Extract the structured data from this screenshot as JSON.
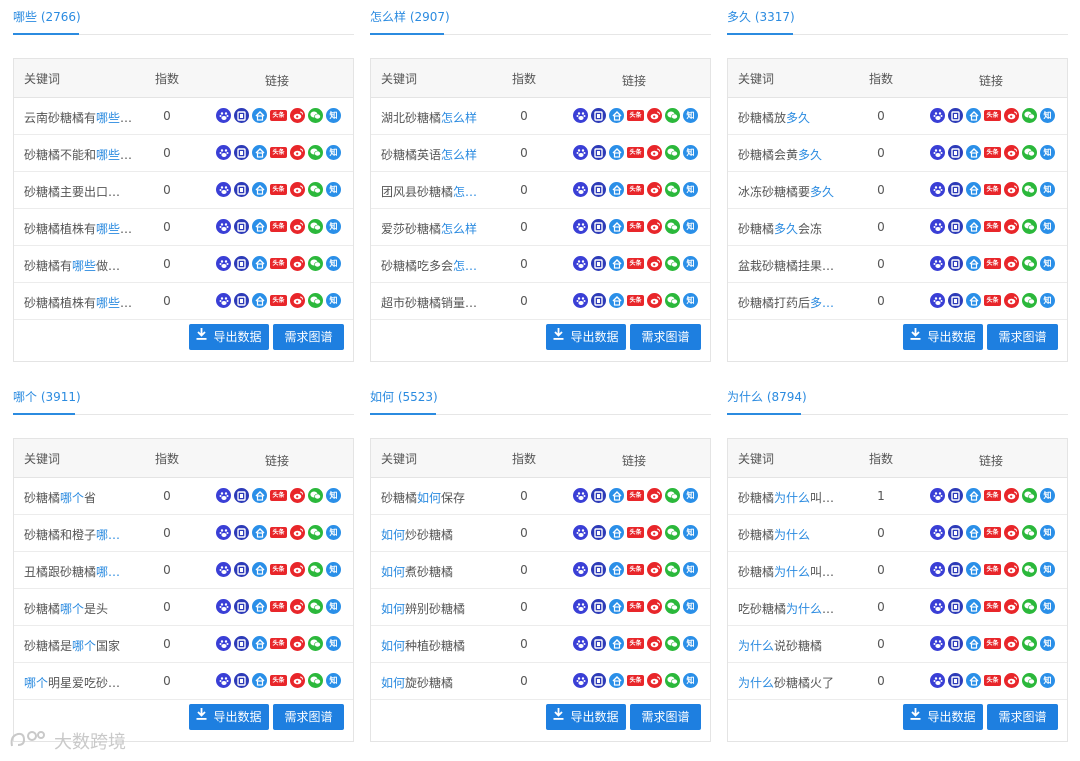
{
  "columns": {
    "keyword": "关键词",
    "index": "指数",
    "links": "链接"
  },
  "buttons": {
    "export": "导出数据",
    "graph": "需求图谱"
  },
  "watermark": "大数跨境",
  "colors": {
    "accent": "#2b8be0",
    "button": "#1e7fe0",
    "baidu": "#3a3fd6",
    "weibo": "#e8262a",
    "wechat": "#2bb83b",
    "zhihu": "#2a8fe8"
  },
  "link_icons": [
    "baidu-icon",
    "docs-icon",
    "baike-icon",
    "toutiao-icon",
    "weibo-icon",
    "wechat-icon",
    "zhihu-icon"
  ],
  "panels": [
    {
      "title": "哪些 (2766)",
      "rows": [
        {
          "pre": "云南砂糖橘有",
          "hl": "哪些",
          "post": "…",
          "index": "0"
        },
        {
          "pre": "砂糖橘不能和",
          "hl": "哪些",
          "post": "…",
          "index": "0"
        },
        {
          "pre": "砂糖橘主要出口…",
          "hl": "",
          "post": "",
          "index": "0"
        },
        {
          "pre": "砂糖橘植株有",
          "hl": "哪些",
          "post": "…",
          "index": "0"
        },
        {
          "pre": "砂糖橘有",
          "hl": "哪些",
          "post": "做…",
          "index": "0"
        },
        {
          "pre": "砂糖橘植株有",
          "hl": "哪些",
          "post": "…",
          "index": "0"
        }
      ]
    },
    {
      "title": "怎么样 (2907)",
      "rows": [
        {
          "pre": "湖北砂糖橘",
          "hl": "怎么样",
          "post": "",
          "index": "0"
        },
        {
          "pre": "砂糖橘英语",
          "hl": "怎么样",
          "post": "",
          "index": "0"
        },
        {
          "pre": "团风县砂糖橘",
          "hl": "怎…",
          "post": "",
          "index": "0"
        },
        {
          "pre": "爱莎砂糖橘",
          "hl": "怎么样",
          "post": "",
          "index": "0"
        },
        {
          "pre": "砂糖橘吃多会",
          "hl": "怎…",
          "post": "",
          "index": "0"
        },
        {
          "pre": "超市砂糖橘销量…",
          "hl": "",
          "post": "",
          "index": "0"
        }
      ]
    },
    {
      "title": "多久 (3317)",
      "rows": [
        {
          "pre": "砂糖橘放",
          "hl": "多久",
          "post": "",
          "index": "0"
        },
        {
          "pre": "砂糖橘会黄",
          "hl": "多久",
          "post": "",
          "index": "0"
        },
        {
          "pre": "冰冻砂糖橘要",
          "hl": "多久",
          "post": "",
          "index": "0"
        },
        {
          "pre": "砂糖橘",
          "hl": "多久",
          "post": "会冻",
          "index": "0"
        },
        {
          "pre": "盆栽砂糖橘挂果…",
          "hl": "",
          "post": "",
          "index": "0"
        },
        {
          "pre": "砂糖橘打药后",
          "hl": "多…",
          "post": "",
          "index": "0"
        }
      ]
    },
    {
      "title": "哪个 (3911)",
      "rows": [
        {
          "pre": "砂糖橘",
          "hl": "哪个",
          "post": "省",
          "index": "0"
        },
        {
          "pre": "砂糖橘和橙子",
          "hl": "哪…",
          "post": "",
          "index": "0"
        },
        {
          "pre": "丑橘跟砂糖橘",
          "hl": "哪…",
          "post": "",
          "index": "0"
        },
        {
          "pre": "砂糖橘",
          "hl": "哪个",
          "post": "是头",
          "index": "0"
        },
        {
          "pre": "砂糖橘是",
          "hl": "哪个",
          "post": "国家",
          "index": "0"
        },
        {
          "pre": "",
          "hl": "哪个",
          "post": "明星爱吃砂…",
          "index": "0"
        }
      ]
    },
    {
      "title": "如何 (5523)",
      "rows": [
        {
          "pre": "砂糖橘",
          "hl": "如何",
          "post": "保存",
          "index": "0"
        },
        {
          "pre": "",
          "hl": "如何",
          "post": "炒砂糖橘",
          "index": "0"
        },
        {
          "pre": "",
          "hl": "如何",
          "post": "煮砂糖橘",
          "index": "0"
        },
        {
          "pre": "",
          "hl": "如何",
          "post": "辨别砂糖橘",
          "index": "0"
        },
        {
          "pre": "",
          "hl": "如何",
          "post": "种植砂糖橘",
          "index": "0"
        },
        {
          "pre": "",
          "hl": "如何",
          "post": "旋砂糖橘",
          "index": "0"
        }
      ]
    },
    {
      "title": "为什么 (8794)",
      "rows": [
        {
          "pre": "砂糖橘",
          "hl": "为什么",
          "post": "叫…",
          "index": "1"
        },
        {
          "pre": "砂糖橘",
          "hl": "为什么",
          "post": "",
          "index": "0"
        },
        {
          "pre": "砂糖橘",
          "hl": "为什么",
          "post": "叫…",
          "index": "0"
        },
        {
          "pre": "吃砂糖橘",
          "hl": "为什么",
          "post": "…",
          "index": "0"
        },
        {
          "pre": "",
          "hl": "为什么",
          "post": "说砂糖橘",
          "index": "0"
        },
        {
          "pre": "",
          "hl": "为什么",
          "post": "砂糖橘火了",
          "index": "0"
        }
      ]
    }
  ]
}
